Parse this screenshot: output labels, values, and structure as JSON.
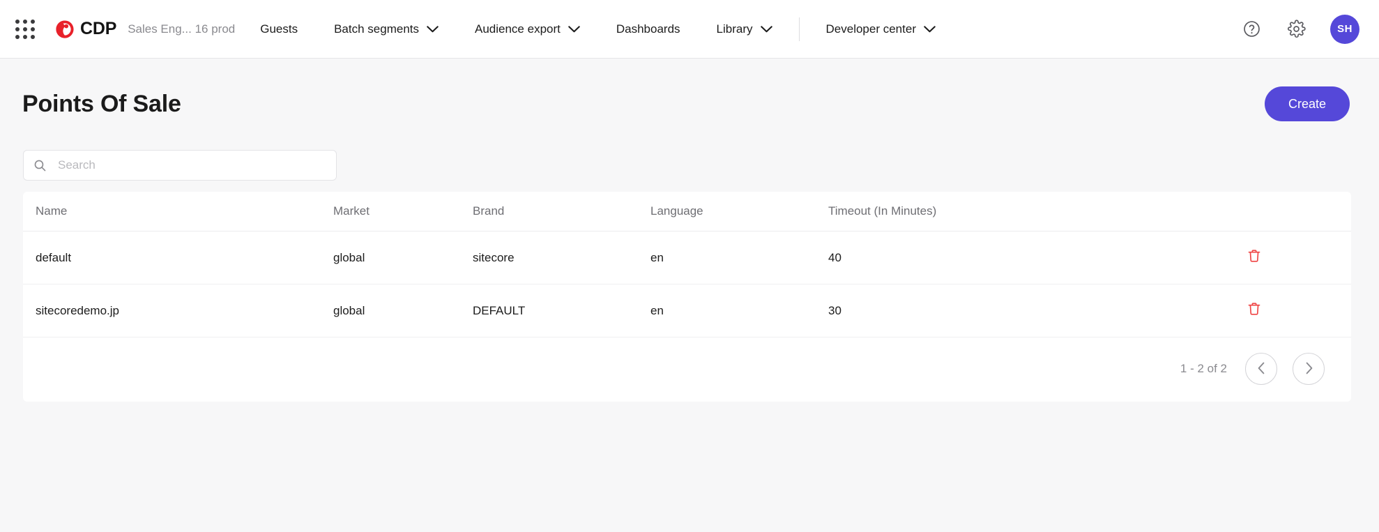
{
  "topnav": {
    "app_grid_icon": "apps-grid-icon",
    "brand": {
      "logo_icon": "sitecore-logo-icon",
      "name": "CDP"
    },
    "tenant": "Sales Eng... 16 prod",
    "items": [
      {
        "label": "Guests",
        "has_caret": false
      },
      {
        "label": "Batch segments",
        "has_caret": true
      },
      {
        "label": "Audience export",
        "has_caret": true
      },
      {
        "label": "Dashboards",
        "has_caret": false
      },
      {
        "label": "Library",
        "has_caret": true
      }
    ],
    "divider_after_index": 4,
    "developer_center": {
      "label": "Developer center",
      "has_caret": true
    },
    "help_icon": "help-circle-icon",
    "settings_icon": "gear-icon",
    "avatar_initials": "SH"
  },
  "page": {
    "title": "Points Of Sale",
    "create_label": "Create"
  },
  "search": {
    "icon": "search-icon",
    "value": "",
    "placeholder": "Search"
  },
  "table": {
    "columns": [
      "Name",
      "Market",
      "Brand",
      "Language",
      "Timeout (In Minutes)"
    ],
    "rows": [
      {
        "name": "default",
        "market": "global",
        "brand": "sitecore",
        "language": "en",
        "timeout": "40",
        "delete_icon": "trash-icon"
      },
      {
        "name": "sitecoredemo.jp",
        "market": "global",
        "brand": "DEFAULT",
        "language": "en",
        "timeout": "30",
        "delete_icon": "trash-icon"
      }
    ]
  },
  "pagination": {
    "range_label": "1 - 2 of 2",
    "prev_icon": "chevron-left-icon",
    "next_icon": "chevron-right-icon"
  },
  "colors": {
    "accent": "#5548d9",
    "danger": "#ef4444",
    "brand_red": "#e8212a",
    "page_bg": "#f7f7f8",
    "card_bg": "#ffffff",
    "muted_text": "#8a8a8f"
  }
}
